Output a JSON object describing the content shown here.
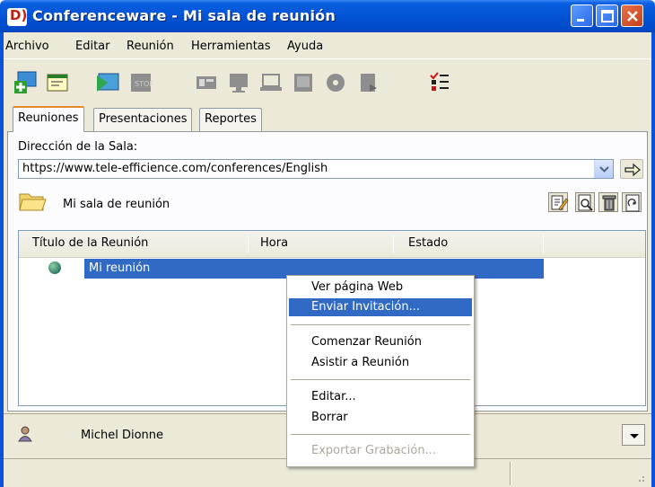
{
  "window": {
    "title": "Conferenceware - Mi sala de reunión",
    "logo_glyph": "D)",
    "colors": {
      "titlebar": "#0353d6",
      "selection": "#316ac5",
      "accent_tab": "#e68b2c"
    }
  },
  "menu": [
    "Archivo",
    "Editar",
    "Reunión",
    "Herramientas",
    "Ayuda"
  ],
  "toolbar_icons": [
    "add-meeting-icon",
    "note-icon",
    "present-icon",
    "stop-icon",
    "window-icon",
    "monitor-icon",
    "laptop-icon",
    "screen-icon",
    "cd-icon",
    "document-icon",
    "checklist-icon"
  ],
  "tabs": [
    "Reuniones",
    "Presentaciones",
    "Reportes"
  ],
  "address": {
    "label": "Dirección de la Sala:",
    "value": "https://www.tele-efficience.com/conferences/English"
  },
  "room": {
    "name": "Mi sala de reunión"
  },
  "room_buttons": [
    "edit-icon",
    "search-doc-icon",
    "delete-icon",
    "export-icon"
  ],
  "table": {
    "columns": [
      "Título de la Reunión",
      "Hora",
      "Estado"
    ],
    "rows": [
      {
        "title": "Mi reunión"
      }
    ]
  },
  "context_menu": {
    "items": [
      "Ver página Web",
      "Enviar Invitación...",
      "Comenzar Reunión",
      "Asistir a Reunión",
      "Editar...",
      "Borrar",
      "Exportar Grabación..."
    ],
    "highlighted": "Enviar Invitación...",
    "disabled": "Exportar Grabación..."
  },
  "user": {
    "name": "Michel Dionne"
  }
}
